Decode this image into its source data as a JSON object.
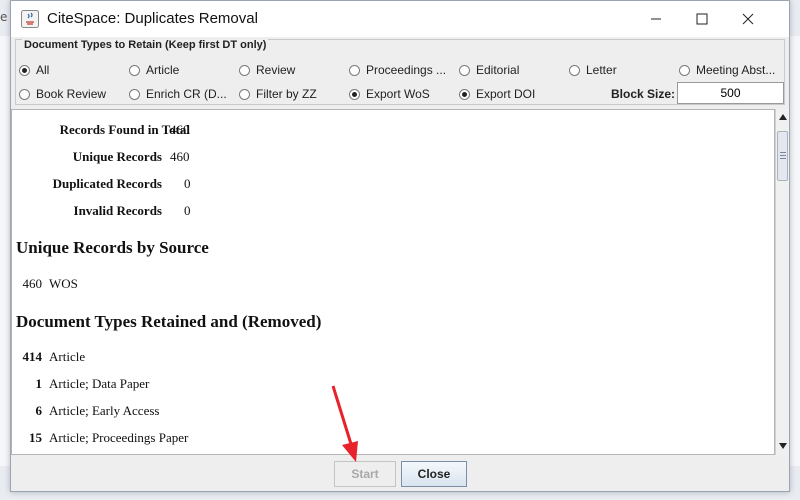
{
  "window": {
    "title": "CiteSpace: Duplicates Removal",
    "background_glyph": "e"
  },
  "options": {
    "group_title": "Document Types to Retain (Keep first DT only)",
    "row1": [
      {
        "label": "All",
        "checked": true
      },
      {
        "label": "Article",
        "checked": false
      },
      {
        "label": "Review",
        "checked": false
      },
      {
        "label": "Proceedings ...",
        "checked": false
      },
      {
        "label": "Editorial",
        "checked": false
      },
      {
        "label": "Letter",
        "checked": false
      },
      {
        "label": "Meeting Abst...",
        "checked": false
      }
    ],
    "row2": [
      {
        "label": "Book Review",
        "checked": false
      },
      {
        "label": "Enrich CR (D...",
        "checked": false
      },
      {
        "label": "Filter by ZZ",
        "checked": false
      },
      {
        "label": "Export WoS",
        "checked": true
      },
      {
        "label": "Export DOI",
        "checked": true
      }
    ],
    "block_size_label": "Block Size:",
    "block_size_value": "500"
  },
  "summary": [
    {
      "label": "Records Found in Total",
      "value": "460"
    },
    {
      "label": "Unique Records",
      "value": "460"
    },
    {
      "label": "Duplicated Records",
      "value": "0"
    },
    {
      "label": "Invalid Records",
      "value": "0"
    }
  ],
  "source_section": {
    "heading": "Unique Records by Source",
    "items": [
      {
        "count": "460",
        "name": "WOS"
      }
    ]
  },
  "doctype_section": {
    "heading": "Document Types Retained and (Removed)",
    "items": [
      {
        "count": "414",
        "name": "Article"
      },
      {
        "count": "1",
        "name": "Article; Data Paper"
      },
      {
        "count": "6",
        "name": "Article; Early Access"
      },
      {
        "count": "15",
        "name": "Article; Proceedings Paper"
      }
    ]
  },
  "buttons": {
    "start": "Start",
    "close": "Close"
  },
  "colors": {
    "annotation_arrow": "#e8212b",
    "disabled_text": "#a8a8a8"
  },
  "icons": [
    "java-app-icon",
    "minimize-icon",
    "maximize-icon",
    "close-icon",
    "scroll-up-icon",
    "scroll-down-icon",
    "annotation-arrow"
  ]
}
